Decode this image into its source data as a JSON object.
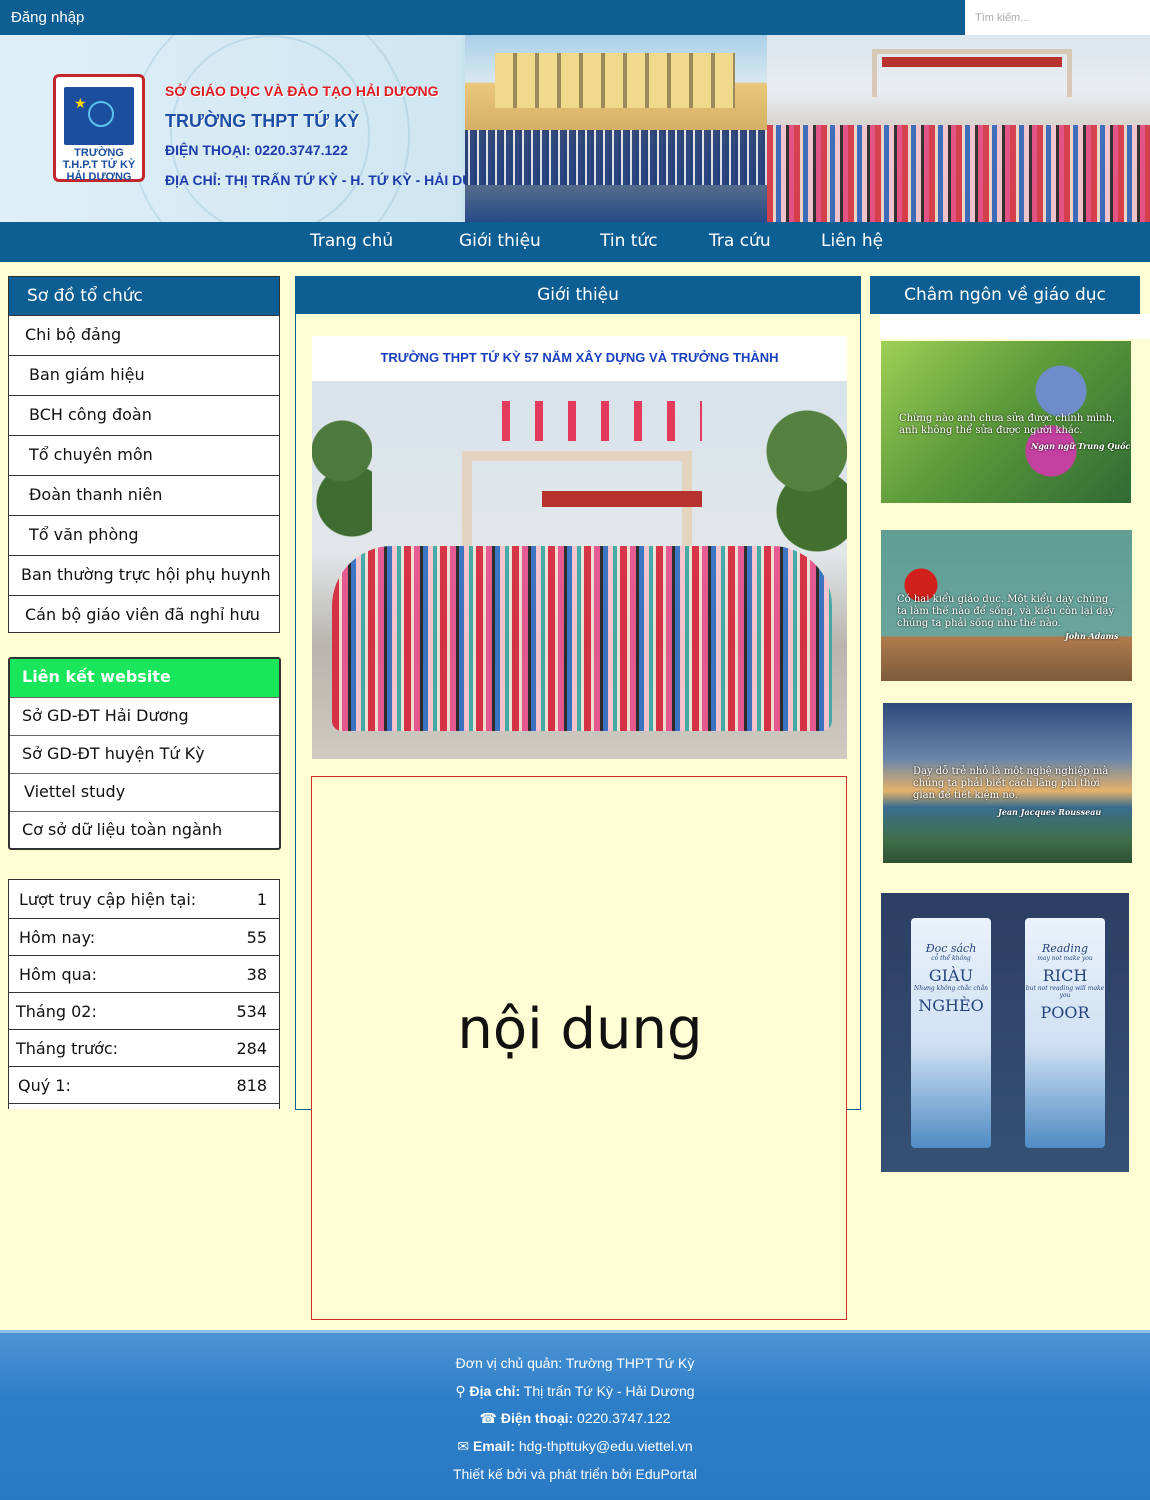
{
  "topbar": {
    "login": "Đăng nhập",
    "search_placeholder": "Tìm kiếm..."
  },
  "banner": {
    "line1": "SỞ GIÁO DỤC VÀ ĐÀO TẠO HẢI DƯƠNG",
    "line2": "TRƯỜNG THPT TỨ KỲ",
    "line3": "ĐIỆN THOẠI: 0220.3747.122",
    "line4": "ĐỊA CHỈ: THỊ TRẤN TỨ KỲ - H. TỨ KỲ - HẢI DƯƠNG",
    "logo_text": "TRƯỜNG T.H.P.T TỨ KỲ HẢI DƯƠNG"
  },
  "nav": [
    "Trang chủ",
    "Giới thiệu",
    "Tin tức",
    "Tra cứu",
    "Liên hệ"
  ],
  "org": {
    "title": "Sơ đồ tổ chức",
    "items": [
      "Chi bộ đảng",
      "Ban giám hiệu",
      "BCH công đoàn",
      "Tổ chuyên môn",
      "Đoàn thanh niên",
      "Tổ văn phòng",
      "Ban thường trực hội phụ huynh",
      "Cán bộ giáo viên đã nghỉ hưu"
    ]
  },
  "links": {
    "title": "Liên kết website",
    "items": [
      "Sở GD-ĐT Hải Dương",
      "Sở GD-ĐT huyện Tứ Kỳ",
      "Viettel study",
      "Cơ sở dữ liệu toàn ngành"
    ]
  },
  "stats": [
    {
      "label": "Lượt truy cập hiện tại:",
      "value": "1"
    },
    {
      "label": "Hôm nay:",
      "value": "55"
    },
    {
      "label": "Hôm qua:",
      "value": "38"
    },
    {
      "label": "Tháng 02:",
      "value": "534"
    },
    {
      "label": "Tháng trước:",
      "value": "284"
    },
    {
      "label": "Quý 1:",
      "value": "818"
    }
  ],
  "center": {
    "title": "Giới thiệu",
    "photo_caption": "TRƯỜNG THPT TỨ KỲ 57 NĂM XÂY DỰNG VÀ TRƯỞNG THÀNH",
    "content": "nội dung"
  },
  "right": {
    "title": "Châm ngôn về giáo dục",
    "quotes": [
      {
        "text": "Chừng nào anh chưa sửa được chính mình, anh không thể sửa được người khác.",
        "author": "Ngạn ngữ Trung Quốc"
      },
      {
        "text": "Có hai kiểu giáo dục. Một kiểu dạy chúng ta làm thế nào để sống, và kiểu còn lại dạy chúng ta phải sống như thế nào.",
        "author": "John Adams"
      },
      {
        "text": "Dạy dỗ trẻ nhỏ là một nghệ nghiệp mà chúng ta phải biết cách lãng phí thời gian để tiết kiệm nó.",
        "author": "Jean Jacques Rousseau"
      }
    ],
    "bookmark_vi": {
      "a": "Đọc sách",
      "s1": "có thể không",
      "b1": "GIÀU",
      "s2": "Nhưng không chắc chắn",
      "b2": "NGHÈO"
    },
    "bookmark_en": {
      "a": "Reading",
      "s1": "may not make you",
      "b1": "RICH",
      "s2": "but not reading will make you",
      "b2": "POOR"
    }
  },
  "footer": {
    "owner": "Đơn vị chủ quản: Trường THPT Tứ Kỳ",
    "address_label": "Địa chỉ:",
    "address": " Thị trấn Tứ Kỳ - Hải Dương",
    "phone_label": "Điện thoại:",
    "phone": " 0220.3747.122",
    "email_label": "Email:",
    "email": " hdg-thpttuky@edu.viettel.vn",
    "credit": "Thiết kế bởi và phát triển bởi EduPortal"
  },
  "colors": {
    "primary": "#0d5f93",
    "background": "#fefdd4",
    "link_header": "#19e65b",
    "banner_red": "#e11b22",
    "banner_blue": "#1e4fa6"
  }
}
